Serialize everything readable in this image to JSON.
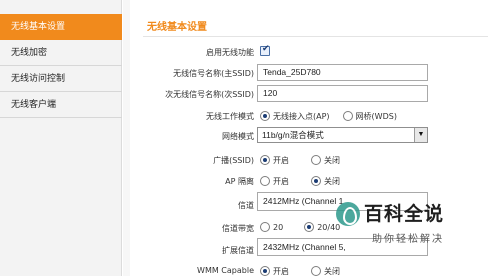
{
  "sidebar": {
    "items": [
      {
        "label": "无线基本设置",
        "active": true
      },
      {
        "label": "无线加密",
        "active": false
      },
      {
        "label": "无线访问控制",
        "active": false
      },
      {
        "label": "无线客户端",
        "active": false
      }
    ]
  },
  "main": {
    "title": "无线基本设置",
    "enable_wireless": {
      "label": "启用无线功能",
      "checked": true
    },
    "ssid_primary": {
      "label": "无线信号名称(主SSID)",
      "value": "Tenda_25D780"
    },
    "ssid_secondary": {
      "label": "次无线信号名称(次SSID)",
      "value": "120"
    },
    "work_mode": {
      "label": "无线工作模式",
      "options": [
        "无线接入点(AP)",
        "网桥(WDS)"
      ],
      "selected": "无线接入点(AP)"
    },
    "network_mode": {
      "label": "网络模式",
      "value": "11b/g/n混合模式"
    },
    "broadcast": {
      "label": "广播(SSID)",
      "options": [
        "开启",
        "关闭"
      ],
      "selected": "开启"
    },
    "ap_isolation": {
      "label": "AP 隔离",
      "options": [
        "开启",
        "关闭"
      ],
      "selected": "关闭"
    },
    "channel": {
      "label": "信道",
      "value": "2412MHz (Channel 1"
    },
    "bandwidth": {
      "label": "信道带宽",
      "options": [
        "20",
        "20/40"
      ],
      "selected": "20/40"
    },
    "ext_channel": {
      "label": "扩展信道",
      "value": "2432MHz (Channel 5,"
    },
    "wmm": {
      "label": "WMM Capable",
      "options": [
        "开启",
        "关闭"
      ],
      "selected": "开启"
    }
  },
  "watermark": {
    "title": "百科全说",
    "subtitle": "助你轻松解决"
  },
  "colors": {
    "accent": "#f18a1c",
    "sidebar_bg": "#f3f3f3"
  }
}
